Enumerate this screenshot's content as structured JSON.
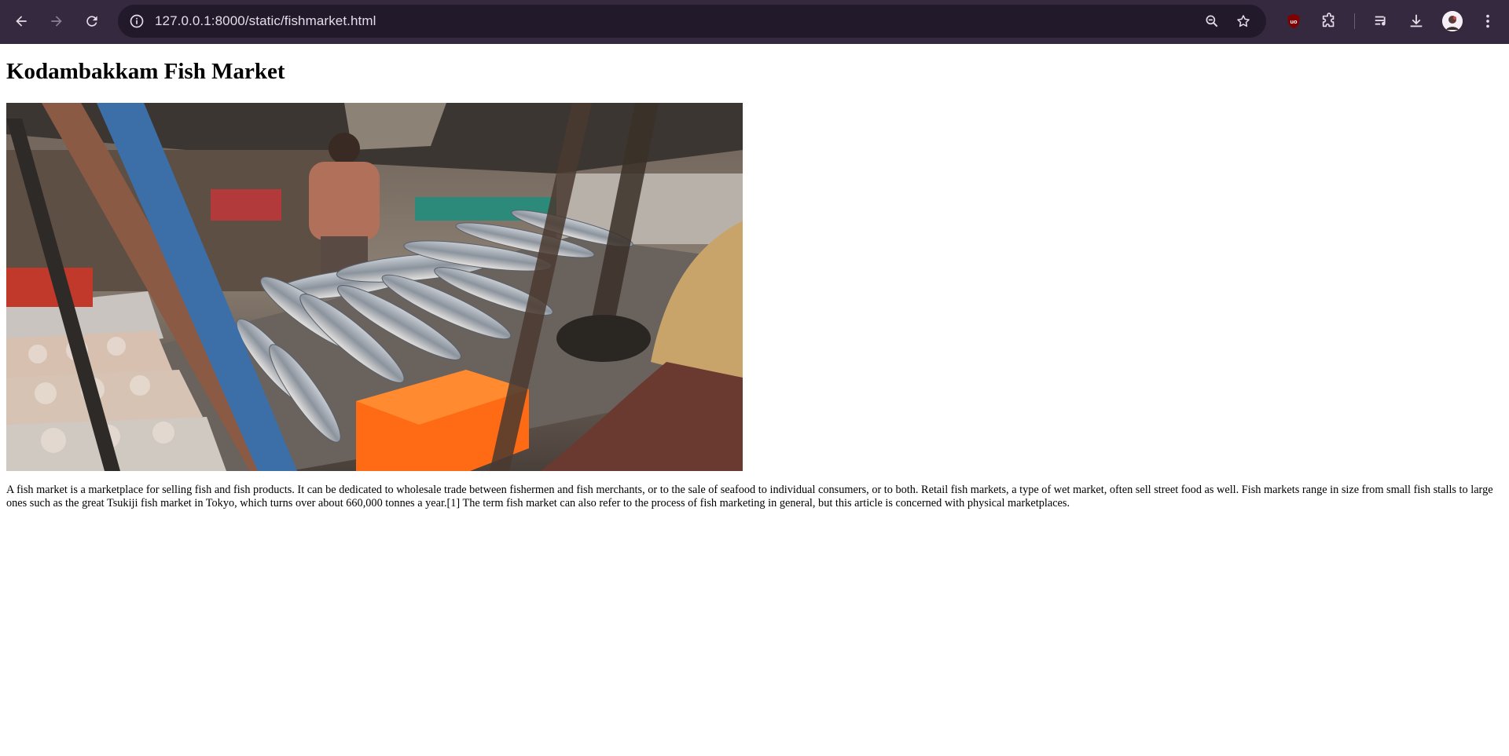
{
  "browser": {
    "url": "127.0.0.1:8000/static/fishmarket.html",
    "nav": {
      "back_icon": "arrow-left-icon",
      "forward_icon": "arrow-right-icon",
      "reload_icon": "reload-icon"
    },
    "omnibox_icons": [
      "site-info-icon",
      "zoom-icon",
      "bookmark-star-icon"
    ],
    "extensions": [
      "ublock-origin-icon",
      "extensions-puzzle-icon",
      "media-queue-icon",
      "download-icon",
      "profile-avatar",
      "kebab-menu-icon"
    ],
    "colors": {
      "toolbar": "#35293f",
      "omnibox": "#221a2b",
      "text": "#e3dde9"
    }
  },
  "page": {
    "title": "Kodambakkam Fish Market",
    "image_alt": "fish market stall with fish laid out on tables",
    "paragraph": "A fish market is a marketplace for selling fish and fish products. It can be dedicated to wholesale trade between fishermen and fish merchants, or to the sale of seafood to individual consumers, or to both. Retail fish markets, a type of wet market, often sell street food as well. Fish markets range in size from small fish stalls to large ones such as the great Tsukiji fish market in Tokyo, which turns over about 660,000 tonnes a year.[1] The term fish market can also refer to the process of fish marketing in general, but this article is concerned with physical marketplaces."
  }
}
